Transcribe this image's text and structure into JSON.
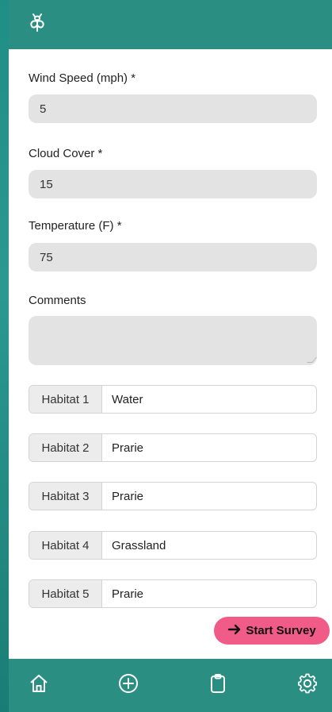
{
  "header": {
    "logo_icon": "insect-icon"
  },
  "form": {
    "wind_speed": {
      "label": "Wind Speed (mph) *",
      "value": "5"
    },
    "cloud_cover": {
      "label": "Cloud Cover *",
      "value": "15"
    },
    "temperature": {
      "label": "Temperature (F) *",
      "value": "75"
    },
    "comments": {
      "label": "Comments",
      "value": ""
    },
    "habitats": [
      {
        "label": "Habitat 1",
        "value": "Water"
      },
      {
        "label": "Habitat 2",
        "value": "Prarie"
      },
      {
        "label": "Habitat 3",
        "value": "Prarie"
      },
      {
        "label": "Habitat 4",
        "value": "Grassland"
      },
      {
        "label": "Habitat 5",
        "value": "Prarie"
      }
    ]
  },
  "actions": {
    "start_survey_label": "Start Survey",
    "start_survey_icon": "arrow-right-icon"
  },
  "nav": {
    "items": [
      {
        "icon": "home-icon"
      },
      {
        "icon": "plus-circle-icon"
      },
      {
        "icon": "clipboard-icon"
      },
      {
        "icon": "gear-icon"
      }
    ]
  },
  "colors": {
    "header_bg": "#2a8f82",
    "input_bg": "#e3e3e3",
    "accent_button": "#f15b87"
  }
}
